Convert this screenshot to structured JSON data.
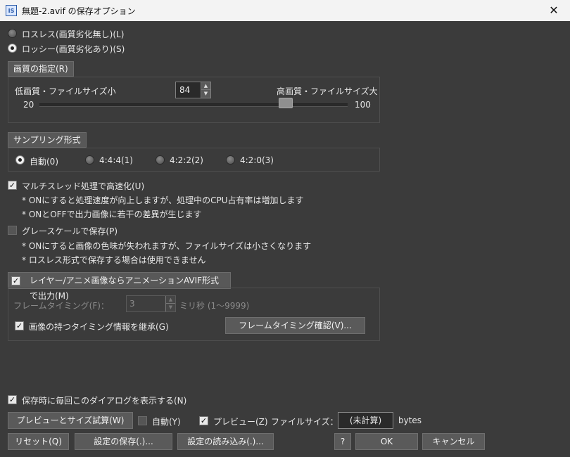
{
  "window": {
    "title": "無題-2.avif の保存オプション",
    "icon": "IS"
  },
  "compression": {
    "lossless_label": "ロスレス(画質劣化無し)(L)",
    "lossy_label": "ロッシー(画質劣化あり)(S)",
    "selected": "lossy"
  },
  "quality": {
    "section_label": "画質の指定(R)",
    "low_label": "低画質・ファイルサイズ小",
    "high_label": "高画質・ファイルサイズ大",
    "value": "84",
    "min": "20",
    "max": "100",
    "slider_fraction": 0.8
  },
  "sampling": {
    "section_label": "サンプリング形式",
    "options": [
      "自動(0)",
      "4:4:4(1)",
      "4:2:2(2)",
      "4:2:0(3)"
    ],
    "selected_index": 0
  },
  "multithread": {
    "label": "マルチスレッド処理で高速化(U)",
    "checked": true,
    "note1": "* ONにすると処理速度が向上しますが、処理中のCPU占有率は増加します",
    "note2": "* ONとOFFで出力画像に若干の差異が生じます"
  },
  "grayscale": {
    "label": "グレースケールで保存(P)",
    "checked": false,
    "note1": "* ONにすると画像の色味が失われますが、ファイルサイズは小さくなります",
    "note2": "* ロスレス形式で保存する場合は使用できません"
  },
  "animation": {
    "section_label": "レイヤー/アニメ画像ならアニメーションAVIF形式で出力(M)",
    "checked": true,
    "frame_timing_label": "フレームタイミング(F)：",
    "frame_timing_value": "3",
    "frame_timing_unit": "ミリ秒 (1～9999)",
    "inherit_label": "画像の持つタイミング情報を継承(G)",
    "inherit_checked": true,
    "confirm_button": "フレームタイミング確認(V)..."
  },
  "show_dialog": {
    "label": "保存時に毎回このダイアログを表示する(N)",
    "checked": true
  },
  "preview": {
    "trial_button": "プレビューとサイズ試算(W)",
    "auto_label": "自動(Y)",
    "auto_checked": false,
    "preview_label": "プレビュー(Z)",
    "preview_checked": true,
    "filesize_label": "ファイルサイズ：",
    "filesize_value": "(未計算)",
    "filesize_unit": "bytes"
  },
  "buttons": {
    "reset": "リセット(Q)",
    "save_settings": "設定の保存(.)...",
    "load_settings": "設定の読み込み(.)...",
    "help": "?",
    "ok": "OK",
    "cancel": "キャンセル"
  }
}
